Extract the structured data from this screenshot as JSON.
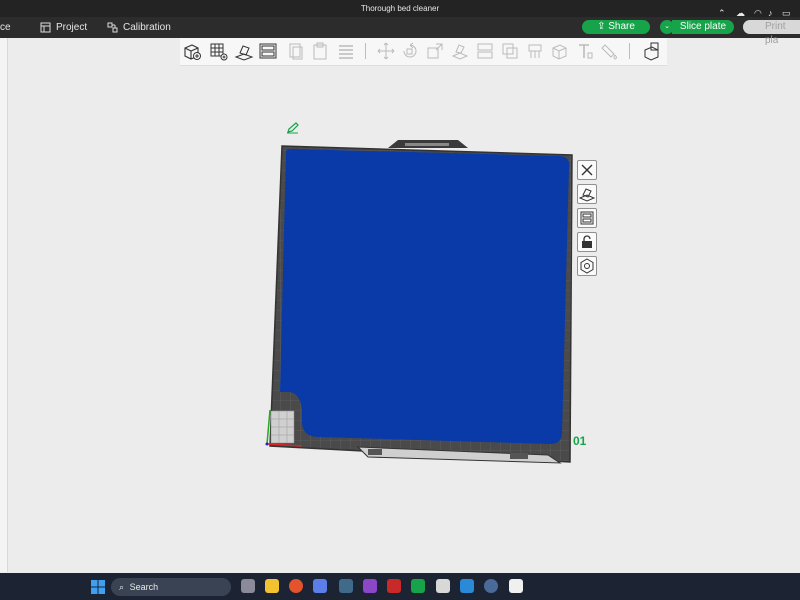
{
  "window": {
    "title": "Thorough bed cleaner"
  },
  "menubar": {
    "prepare_fragment": "ce",
    "project_label": "Project",
    "calibration_label": "Calibration",
    "share_label": "Share",
    "slice_label": "Slice plate",
    "print_label": "Print pla"
  },
  "toolbar": {
    "icons": [
      "add-object-icon",
      "grid-icon",
      "auto-orient-icon",
      "arrange-icon",
      "copy-icon",
      "paste-icon",
      "layers-icon",
      "move-icon",
      "rotate-icon",
      "scale-icon",
      "lay-on-face-icon",
      "cut-icon",
      "boolean-icon",
      "support-paint-icon",
      "seam-paint-icon",
      "text-icon",
      "color-paint-icon",
      "assembly-icon"
    ]
  },
  "plate": {
    "number": "01",
    "color": "#0a3aa8"
  },
  "side_buttons": [
    "close-icon",
    "orient-plate-icon",
    "arrange-plate-icon",
    "lock-icon",
    "settings-icon"
  ],
  "colors": {
    "accent": "#16a34a",
    "titlebar": "#232323",
    "menubar": "#2c2c2c",
    "taskbar": "#1c2433"
  },
  "taskbar": {
    "search_placeholder": "Search"
  }
}
